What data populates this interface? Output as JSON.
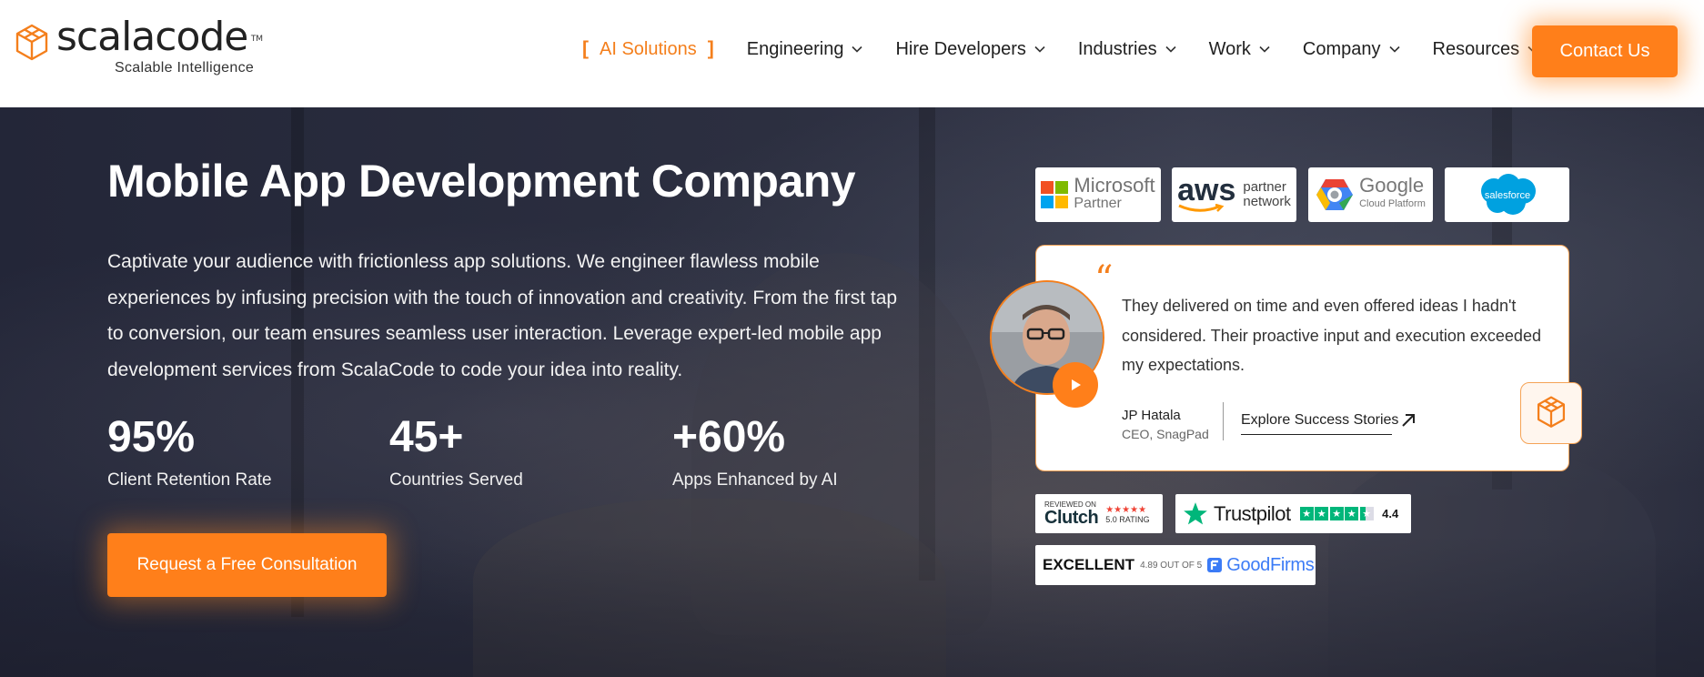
{
  "header": {
    "logo": {
      "word": "scalacode",
      "tm": "TM",
      "tagline": "Scalable Intelligence"
    },
    "nav": [
      {
        "label": "AI Solutions",
        "dropdown": false,
        "highlight": true
      },
      {
        "label": "Engineering",
        "dropdown": true
      },
      {
        "label": "Hire Developers",
        "dropdown": true
      },
      {
        "label": "Industries",
        "dropdown": true
      },
      {
        "label": "Work",
        "dropdown": true
      },
      {
        "label": "Company",
        "dropdown": true
      },
      {
        "label": "Resources",
        "dropdown": true
      }
    ],
    "contact_label": "Contact Us"
  },
  "hero": {
    "title": "Mobile App Development Company",
    "description": "Captivate your audience with frictionless app solutions. We engineer flawless mobile experiences by infusing precision with the touch of innovation and creativity. From the first tap to conversion, our team ensures seamless user interaction. Leverage expert-led mobile app development services from ScalaCode to code your idea into reality.",
    "stats": [
      {
        "value": "95%",
        "label": "Client Retention Rate"
      },
      {
        "value": "45+",
        "label": "Countries Served"
      },
      {
        "value": "+60%",
        "label": "Apps Enhanced by AI"
      }
    ],
    "cta_label": "Request a Free Consultation"
  },
  "partners": {
    "microsoft": {
      "name": "Microsoft",
      "sub": "Partner"
    },
    "aws": {
      "name": "aws",
      "sub1": "partner",
      "sub2": "network"
    },
    "google": {
      "name": "Google",
      "sub": "Cloud Platform"
    },
    "salesforce": {
      "name": "salesforce"
    }
  },
  "testimonial": {
    "quote": "They delivered on time and even offered ideas I hadn't considered. Their proactive input and execution exceeded my expectations.",
    "name": "JP Hatala",
    "role": "CEO, SnagPad",
    "link_label": "Explore Success Stories"
  },
  "ratings": {
    "clutch": {
      "top": "REVIEWED ON",
      "brand": "Clutch",
      "rating": "5.0 RATING",
      "stars": "★★★★★"
    },
    "trustpilot": {
      "brand": "Trustpilot",
      "score": "4.4"
    },
    "goodfirms": {
      "label": "EXCELLENT",
      "score": "4.89 OUT OF 5",
      "brand": "GoodFirms"
    }
  },
  "colors": {
    "accent": "#ff7f1a",
    "trustpilot_green": "#00b67a",
    "goodfirms_blue": "#3b7bf6"
  }
}
